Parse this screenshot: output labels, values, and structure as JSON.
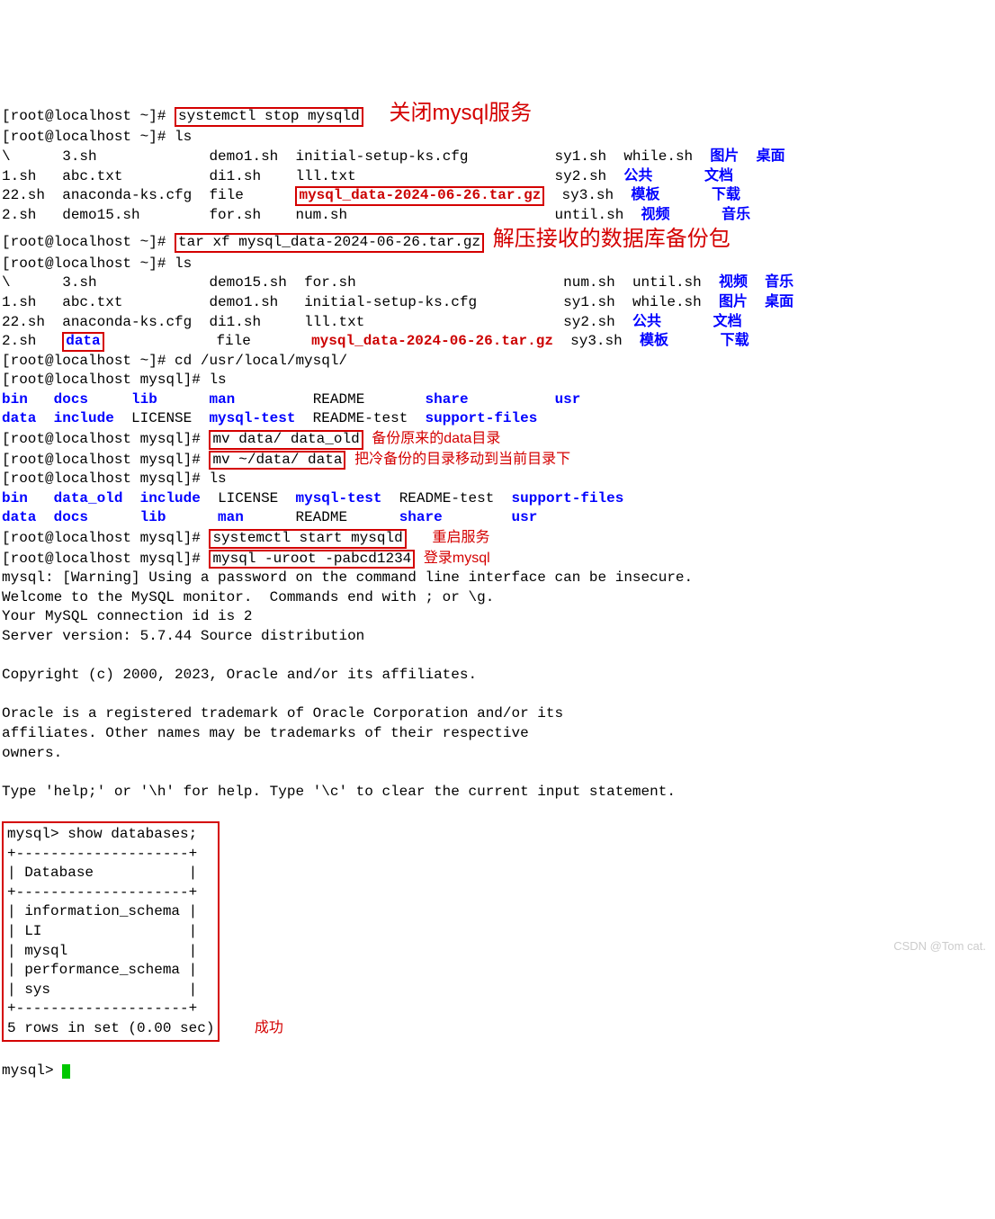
{
  "prompt_root": "[root@localhost ~]# ",
  "prompt_mysql_dir": "[root@localhost mysql]# ",
  "cmd_stop": "systemctl stop mysqld",
  "ann_stop": "关闭mysql服务",
  "cmd_ls": "ls",
  "ls1": {
    "c1": [
      "\\",
      "1.sh",
      "22.sh",
      "2.sh"
    ],
    "c2": [
      "3.sh",
      "abc.txt",
      "anaconda-ks.cfg",
      "demo15.sh"
    ],
    "c3": [
      "demo1.sh",
      "di1.sh",
      "file",
      "for.sh"
    ],
    "c4": [
      "initial-setup-ks.cfg",
      "lll.txt",
      "mysql_data-2024-06-26.tar.gz",
      "num.sh"
    ],
    "c5": [
      "sy1.sh",
      "sy2.sh",
      "sy3.sh",
      "until.sh"
    ],
    "c6": [
      "while.sh",
      "公共",
      "模板",
      "视频"
    ],
    "c7": [
      "图片",
      "文档",
      "下载",
      "音乐"
    ],
    "c8": [
      "桌面",
      "",
      "",
      ""
    ]
  },
  "cmd_tar": "tar xf mysql_data-2024-06-26.tar.gz",
  "ann_tar": "解压接收的数据库备份包",
  "ls2": {
    "c1": [
      "\\",
      "1.sh",
      "22.sh",
      "2.sh"
    ],
    "c2": [
      "3.sh",
      "abc.txt",
      "anaconda-ks.cfg",
      "data"
    ],
    "c3": [
      "demo15.sh",
      "demo1.sh",
      "di1.sh",
      "file"
    ],
    "c4": [
      "for.sh",
      "initial-setup-ks.cfg",
      "lll.txt",
      "mysql_data-2024-06-26.tar.gz"
    ],
    "c5": [
      "num.sh",
      "sy1.sh",
      "sy2.sh",
      "sy3.sh"
    ],
    "c6": [
      "until.sh",
      "while.sh",
      "公共",
      "模板"
    ],
    "c7": [
      "视频",
      "图片",
      "文档",
      "下载"
    ],
    "c8": [
      "音乐",
      "桌面",
      "",
      ""
    ]
  },
  "cmd_cd": "cd /usr/local/mysql/",
  "ls3_row1": [
    "bin",
    "docs",
    "lib",
    "man",
    "README",
    "share",
    "usr"
  ],
  "ls3_row2": [
    "data",
    "include",
    "LICENSE",
    "mysql-test",
    "README-test",
    "support-files"
  ],
  "cmd_mv1": "mv data/ data_old",
  "ann_mv1": "备份原来的data目录",
  "cmd_mv2": "mv ~/data/ data",
  "ann_mv2": "把冷备份的目录移动到当前目录下",
  "ls4_row1": [
    "bin",
    "data_old",
    "include",
    "LICENSE",
    "mysql-test",
    "README-test",
    "support-files"
  ],
  "ls4_row2": [
    "data",
    "docs",
    "lib",
    "man",
    "README",
    "share",
    "usr"
  ],
  "cmd_start": "systemctl start mysqld",
  "ann_start": "重启服务",
  "cmd_login": "mysql -uroot -pabcd1234",
  "ann_login": "登录mysql",
  "mysql_out": [
    "mysql: [Warning] Using a password on the command line interface can be insecure.",
    "Welcome to the MySQL monitor.  Commands end with ; or \\g.",
    "Your MySQL connection id is 2",
    "Server version: 5.7.44 Source distribution",
    "",
    "Copyright (c) 2000, 2023, Oracle and/or its affiliates.",
    "",
    "Oracle is a registered trademark of Oracle Corporation and/or its",
    "affiliates. Other names may be trademarks of their respective",
    "owners.",
    "",
    "Type 'help;' or '\\h' for help. Type '\\c' to clear the current input statement.",
    ""
  ],
  "db_prompt": "mysql> ",
  "db_cmd": "show databases;",
  "db_sep": "+--------------------+",
  "db_header": "| Database           |",
  "db_rows": [
    "| information_schema |",
    "| LI                 |",
    "| mysql              |",
    "| performance_schema |",
    "| sys                |"
  ],
  "db_footer": "5 rows in set (0.00 sec)",
  "ann_db": "成功",
  "final_prompt": "mysql> ",
  "watermark": "CSDN @Tom cat."
}
